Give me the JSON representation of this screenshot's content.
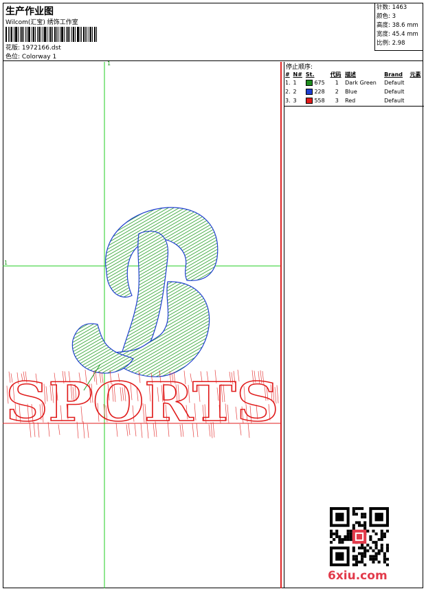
{
  "header": {
    "title": "生产作业图",
    "subtitle": "Wilcom(汇宝) 绣饰工作室",
    "design_label": "花版:",
    "design_value": "1972166.dst",
    "colorway_label": "色位:",
    "colorway_value": "Colorway 1"
  },
  "stats": {
    "stitches_label": "针数:",
    "stitches_value": "1463",
    "colors_label": "颜色:",
    "colors_value": "3",
    "height_label": "高度:",
    "height_value": "38.6 mm",
    "width_label": "宽度:",
    "width_value": "45.4 mm",
    "scale_label": "比例:",
    "scale_value": "2.98"
  },
  "stop_sequence": {
    "title": "停止顺序:",
    "columns": [
      "#",
      "N#",
      "St.",
      "代码",
      "描述",
      "Brand",
      "元素"
    ],
    "rows": [
      {
        "idx": "1.",
        "n": "1",
        "st": "675",
        "code": "1",
        "desc": "Dark Green",
        "brand": "Default",
        "color": "#1e8c1e"
      },
      {
        "idx": "2.",
        "n": "2",
        "st": "228",
        "code": "2",
        "desc": "Blue",
        "brand": "Default",
        "color": "#1f3fd0"
      },
      {
        "idx": "3.",
        "n": "3",
        "st": "558",
        "code": "3",
        "desc": "Red",
        "brand": "Default",
        "color": "#e01b1b"
      }
    ]
  },
  "guides": {
    "vertical_label": "1",
    "horizontal_label": "1"
  },
  "design": {
    "text": "SPORTS",
    "colors": {
      "green": "#1e9a1e",
      "blue": "#1f3fd0",
      "red": "#e01b1b",
      "guide": "#22cc22"
    }
  },
  "watermark": "6xiu.com"
}
